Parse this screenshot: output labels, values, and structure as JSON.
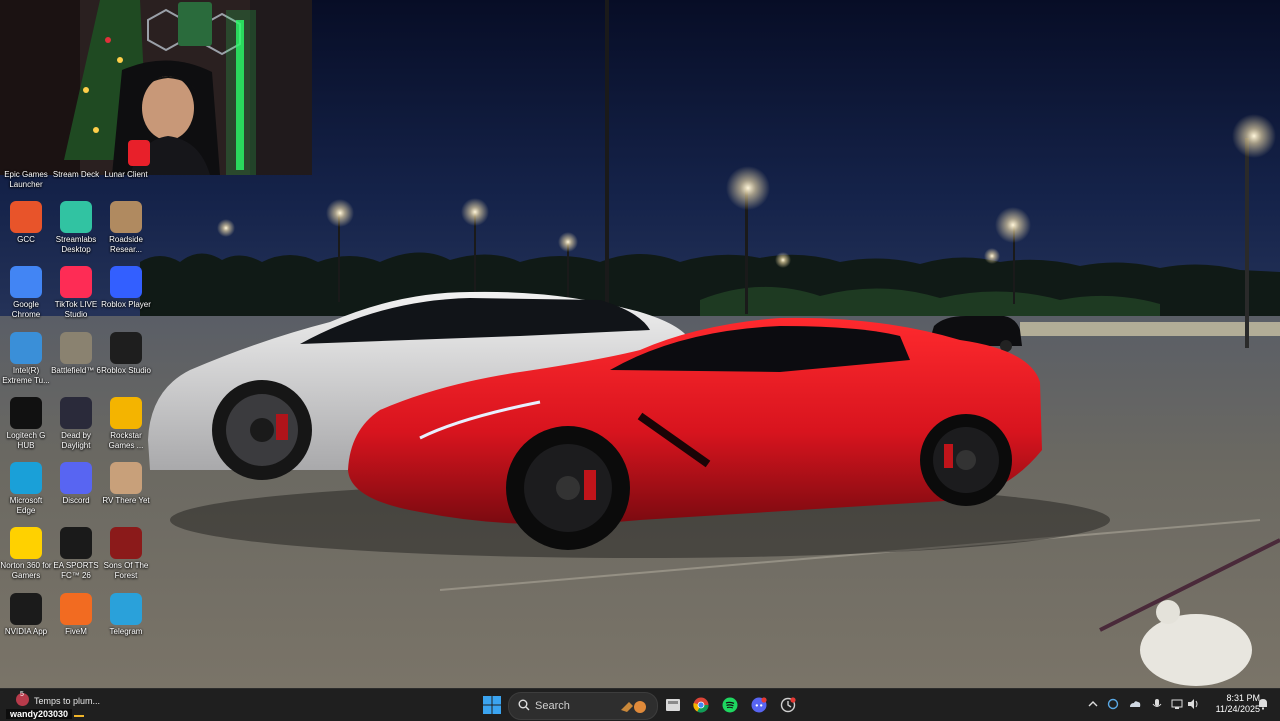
{
  "desktop": {
    "top_row_partial": [
      {
        "label": "Epic Games Launcher"
      },
      {
        "label": "Stream Deck"
      },
      {
        "label": "Lunar Client"
      }
    ],
    "icons": [
      {
        "label": "GCC",
        "icon": "gcc-icon",
        "color": "#e8542a"
      },
      {
        "label": "Streamlabs Desktop",
        "icon": "streamlabs-icon",
        "color": "#31c3a2"
      },
      {
        "label": "Roadside Resear...",
        "icon": "roadside-research-icon",
        "color": "#b08a60"
      },
      {
        "label": "Google Chrome",
        "icon": "chrome-icon",
        "color": "#4285f4"
      },
      {
        "label": "TikTok LIVE Studio",
        "icon": "tiktok-icon",
        "color": "#fe2c55"
      },
      {
        "label": "Roblox Player",
        "icon": "roblox-player-icon",
        "color": "#335fff"
      },
      {
        "label": "Intel(R) Extreme Tu...",
        "icon": "intel-xtu-icon",
        "color": "#3a8fd8"
      },
      {
        "label": "Battlefield™ 6",
        "icon": "battlefield-icon",
        "color": "#8a8270"
      },
      {
        "label": "Roblox Studio",
        "icon": "roblox-studio-icon",
        "color": "#1e1e1e"
      },
      {
        "label": "Logitech G HUB",
        "icon": "logitech-ghub-icon",
        "color": "#111111"
      },
      {
        "label": "Dead by Daylight",
        "icon": "dead-by-daylight-icon",
        "color": "#2a2a3a"
      },
      {
        "label": "Rockstar Games ...",
        "icon": "rockstar-icon",
        "color": "#f4b400"
      },
      {
        "label": "Microsoft Edge",
        "icon": "edge-icon",
        "color": "#1aa0d8"
      },
      {
        "label": "Discord",
        "icon": "discord-icon",
        "color": "#5865f2"
      },
      {
        "label": "RV There Yet",
        "icon": "rv-there-yet-icon",
        "color": "#c8a07a"
      },
      {
        "label": "Norton 360 for Gamers",
        "icon": "norton-icon",
        "color": "#ffd100"
      },
      {
        "label": "EA SPORTS FC™ 26",
        "icon": "ea-fc-icon",
        "color": "#1a1a1a"
      },
      {
        "label": "Sons Of The Forest",
        "icon": "sons-of-the-forest-icon",
        "color": "#8b1a1a"
      },
      {
        "label": "NVIDIA App",
        "icon": "nvidia-icon",
        "color": "#1b1b1b"
      },
      {
        "label": "FiveM",
        "icon": "fivem-icon",
        "color": "#f26b21"
      },
      {
        "label": "Telegram",
        "icon": "telegram-icon",
        "color": "#2aa1da"
      }
    ]
  },
  "notification": {
    "title": "Temps to plum...",
    "username": "wandy203030",
    "badge": "5"
  },
  "taskbar": {
    "search_placeholder": "Search",
    "pinned": [
      {
        "name": "start-button",
        "icon": "windows-icon"
      },
      {
        "name": "file-explorer-button",
        "icon": "folder-icon"
      },
      {
        "name": "chrome-taskbar-button",
        "icon": "chrome-icon"
      },
      {
        "name": "spotify-taskbar-button",
        "icon": "spotify-icon"
      },
      {
        "name": "discord-taskbar-button",
        "icon": "discord-icon"
      },
      {
        "name": "app-taskbar-button",
        "icon": "app-icon"
      }
    ],
    "clock": {
      "time": "8:31 PM",
      "date": "11/24/2025"
    }
  },
  "colors": {
    "taskbar_bg": "#1f1f1f",
    "accent": "#0078d4",
    "car_red": "#d8141e"
  }
}
